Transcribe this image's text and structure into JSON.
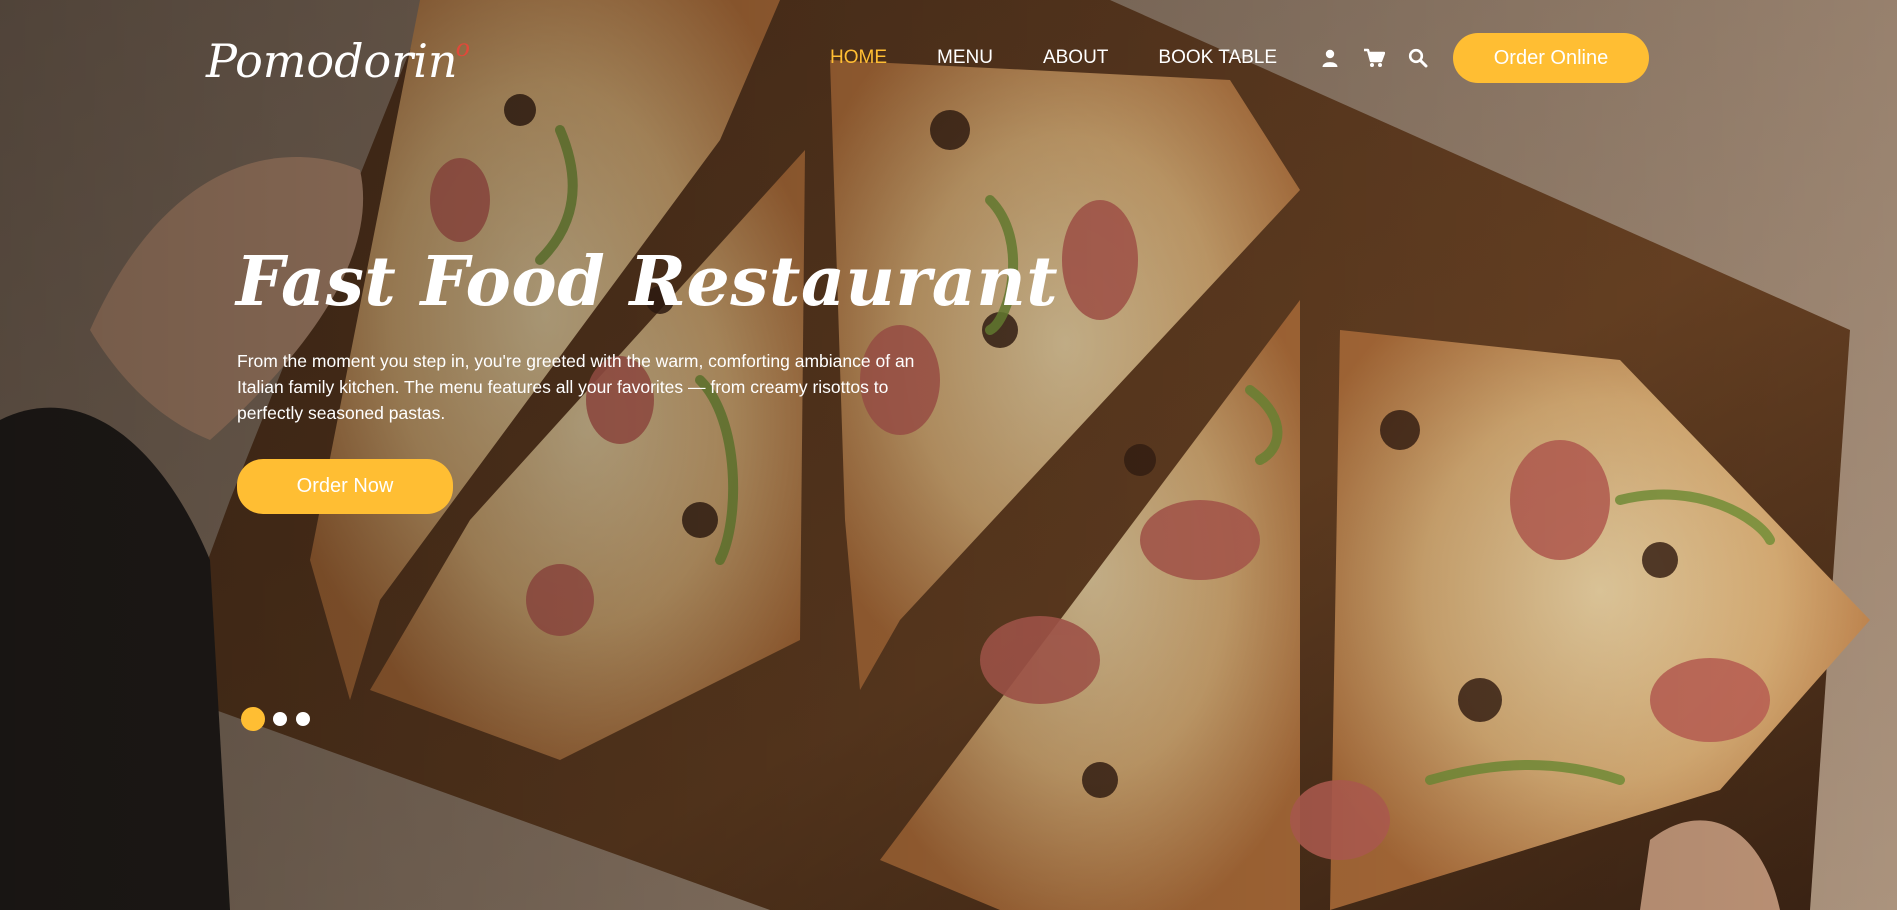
{
  "brand": {
    "logo_text": "Pomodorin",
    "logo_mark": "o"
  },
  "nav": {
    "items": [
      {
        "label": "HOME",
        "active": true
      },
      {
        "label": "MENU",
        "active": false
      },
      {
        "label": "ABOUT",
        "active": false
      },
      {
        "label": "BOOK TABLE",
        "active": false
      }
    ],
    "icons": [
      "user-icon",
      "cart-icon",
      "search-icon"
    ],
    "cta_label": "Order Online"
  },
  "hero": {
    "title": "Fast Food Restaurant",
    "description": "From the moment you step in, you're greeted with the warm, comforting ambiance of an Italian family kitchen. The menu features all your favorites — from creamy risottos to perfectly seasoned pastas.",
    "cta_label": "Order Now",
    "background_image": "pizza-on-wooden-board"
  },
  "carousel": {
    "slides": 3,
    "active_index": 0
  },
  "colors": {
    "accent": "#ffbe33",
    "text": "#ffffff",
    "logo_accent": "#e0493a"
  }
}
